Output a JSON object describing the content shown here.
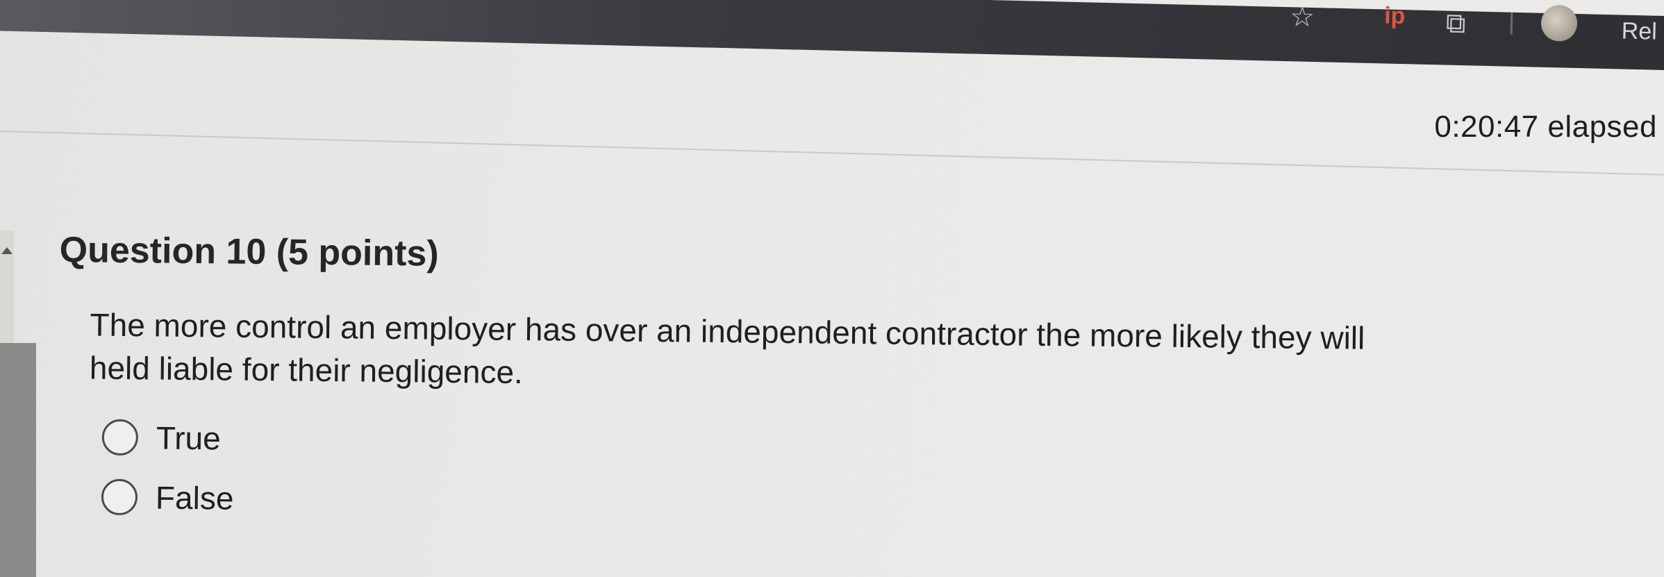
{
  "browser": {
    "reload_label": "Rel",
    "icons": [
      "star-icon",
      "ip-icon",
      "extensions-icon",
      "profile-avatar"
    ]
  },
  "timer": {
    "elapsed_text": "0:20:47 elapsed"
  },
  "question": {
    "number_label": "Question 10",
    "points_label": "(5 points)",
    "prompt": "The more control an employer has over an independent contractor the more likely they will held liable for their negligence.",
    "options": [
      {
        "label": "True",
        "selected": false
      },
      {
        "label": "False",
        "selected": false
      }
    ]
  },
  "colors": {
    "page_background": "#e9e9e7",
    "toolbar": "#3a3b40",
    "text": "#1f1f1f",
    "ip_icon": "#e0553f"
  }
}
